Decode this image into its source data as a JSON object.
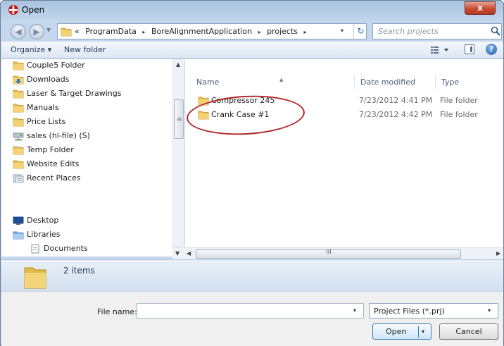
{
  "window": {
    "title": "Open",
    "close_label": "x"
  },
  "address_bar": {
    "overflow_marker": "«",
    "crumbs": [
      "ProgramData",
      "BoreAlignmentApplication",
      "projects"
    ],
    "separator": "▸",
    "dropdown": "▾",
    "refresh": "↻"
  },
  "search": {
    "placeholder": "Search projects"
  },
  "toolbar": {
    "organize_label": "Organize ▾",
    "new_folder_label": "New folder",
    "views_arrow": "▾",
    "help_label": "?"
  },
  "nav_pane": {
    "items": [
      {
        "label": "Couple5 Folder",
        "icon": "folder-icon"
      },
      {
        "label": "Downloads",
        "icon": "downloads-folder-icon"
      },
      {
        "label": "Laser & Target Drawings",
        "icon": "folder-icon"
      },
      {
        "label": "Manuals",
        "icon": "folder-icon"
      },
      {
        "label": "Price Lists",
        "icon": "folder-icon"
      },
      {
        "label": "sales (hl-file) (S)",
        "icon": "network-drive-icon"
      },
      {
        "label": "Temp Folder",
        "icon": "folder-icon"
      },
      {
        "label": "Website Edits",
        "icon": "folder-icon"
      },
      {
        "label": "Recent Places",
        "icon": "recent-places-icon"
      },
      {
        "label": "Desktop",
        "icon": "desktop-icon"
      },
      {
        "label": "Libraries",
        "icon": "libraries-icon"
      },
      {
        "label": "Documents",
        "icon": "documents-icon"
      }
    ]
  },
  "file_list": {
    "columns": {
      "name": "Name",
      "date": "Date modified",
      "type": "Type"
    },
    "rows": [
      {
        "name": "Compressor 245",
        "date": "7/23/2012 4:41 PM",
        "type": "File folder"
      },
      {
        "name": "Crank Case #1",
        "date": "7/23/2012 4:42 PM",
        "type": "File folder"
      }
    ],
    "scroll_grip": "III"
  },
  "details_pane": {
    "item_count": "2 items"
  },
  "bottom": {
    "file_name_label": "File name:",
    "file_name_value": "",
    "filter_value": "Project Files (*.prj)",
    "open_label": "Open",
    "cancel_label": "Cancel",
    "dropdown_arrow": "▾"
  },
  "colors": {
    "accent": "#1e395b",
    "highlight_circle": "#b0282a",
    "close_button": "#c74a30",
    "folder": "#e9c35a"
  }
}
